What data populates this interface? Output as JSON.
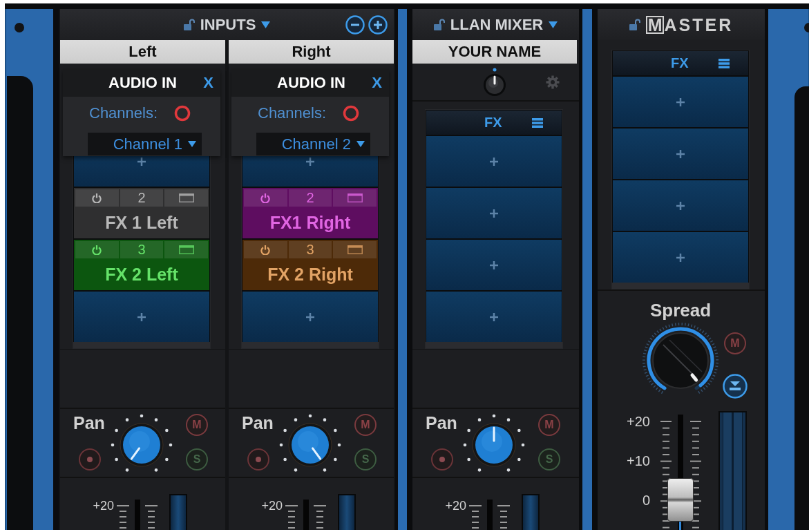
{
  "inputs": {
    "title": "INPUTS",
    "channels": [
      {
        "name": "Left",
        "source": {
          "title": "AUDIO IN",
          "close": "X",
          "label": "Channels:",
          "value": "Channel 1"
        },
        "fx": {
          "slots": [
            {
              "kind": "empty"
            },
            {
              "kind": "effect",
              "number": "2",
              "name": "FX 1 Left",
              "color": "#2f2f30"
            },
            {
              "kind": "effect",
              "number": "3",
              "name": "FX 2 Left",
              "color": "#0c560f"
            },
            {
              "kind": "empty"
            }
          ]
        },
        "pan": {
          "label": "Pan",
          "kind": "left"
        },
        "mute": "M",
        "solo": "S",
        "fader": {
          "scale": [
            "+20"
          ]
        }
      },
      {
        "name": "Right",
        "source": {
          "title": "AUDIO IN",
          "close": "X",
          "label": "Channels:",
          "value": "Channel 2"
        },
        "fx": {
          "slots": [
            {
              "kind": "empty"
            },
            {
              "kind": "effect",
              "number": "2",
              "name": "FX1 Right",
              "color": "#5e0d60"
            },
            {
              "kind": "effect",
              "number": "3",
              "name": "FX 2 Right",
              "color": "#4d2a08"
            },
            {
              "kind": "empty"
            }
          ]
        },
        "pan": {
          "label": "Pan",
          "kind": "right"
        },
        "mute": "M",
        "solo": "S",
        "fader": {
          "scale": [
            "+20"
          ]
        }
      }
    ]
  },
  "mixer": {
    "title": "LLAN MIXER",
    "name": "YOUR NAME",
    "gain": {
      "level": 0.5
    },
    "fx": {
      "title": "FX",
      "slots": [
        {
          "kind": "empty"
        },
        {
          "kind": "empty"
        },
        {
          "kind": "empty"
        },
        {
          "kind": "empty"
        }
      ]
    },
    "pan": {
      "label": "Pan",
      "kind": "center"
    },
    "mute": "M",
    "solo": "S",
    "fader": {
      "scale": [
        "+20"
      ]
    }
  },
  "master": {
    "title": "MASTER",
    "fx": {
      "title": "FX",
      "slots": [
        {
          "kind": "empty"
        },
        {
          "kind": "empty"
        },
        {
          "kind": "empty"
        },
        {
          "kind": "empty"
        }
      ]
    },
    "spread": {
      "label": "Spread",
      "level": 0.97
    },
    "mute": "M",
    "fader": {
      "scale": [
        "+20",
        "+10",
        "0"
      ],
      "level": 0.26
    }
  }
}
